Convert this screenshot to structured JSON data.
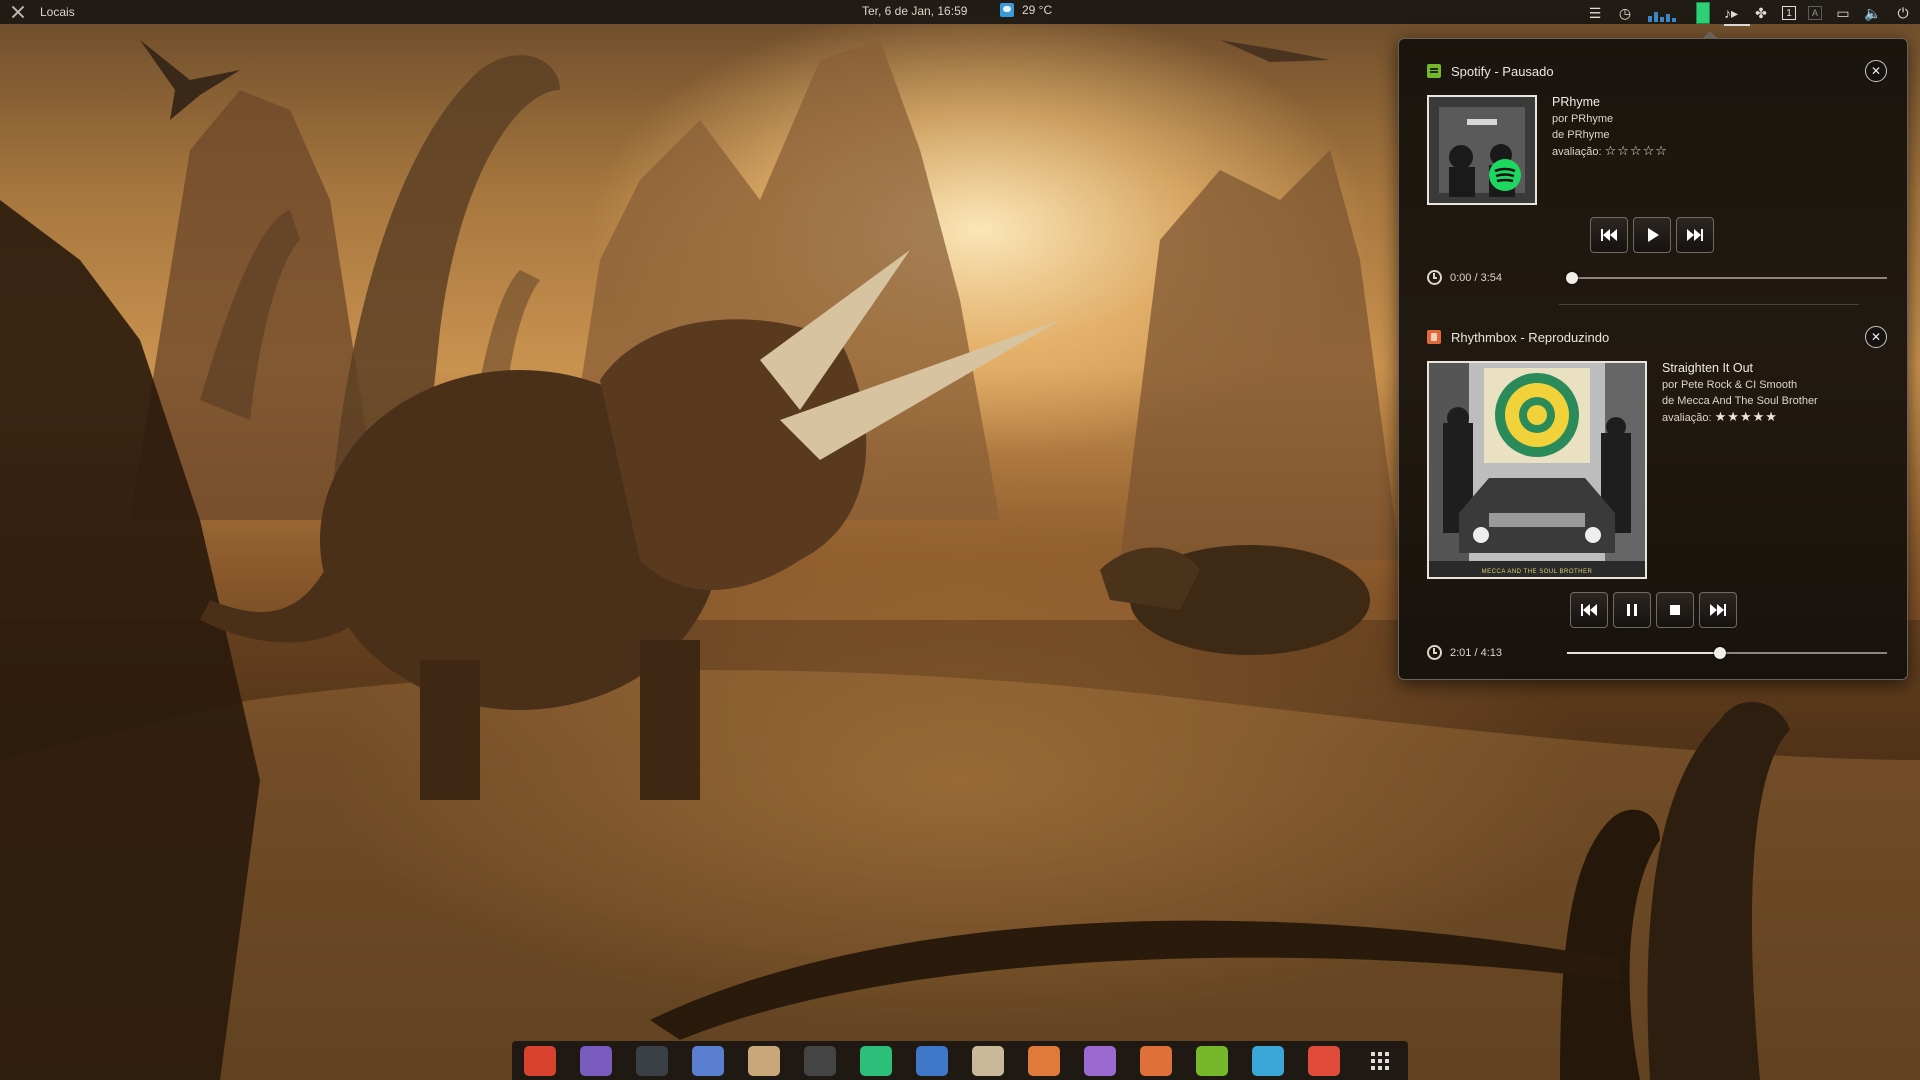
{
  "topbar": {
    "places_label": "Locais",
    "clock": "Ter, 6 de Jan, 16:59",
    "temperature": "29 °C",
    "tray_icons": [
      "settings-sliders-icon",
      "history-icon",
      "network-graph-icon",
      "battery-meter-icon",
      "music-note-icon",
      "extensions-icon",
      "workspace-1-icon",
      "keyboard-layout-icon",
      "display-icon",
      "volume-icon",
      "power-icon"
    ]
  },
  "players": [
    {
      "header": "Spotify - Pausado",
      "app_icon": "spotify-icon",
      "title": "PRhyme",
      "artist": "por PRhyme",
      "album": "de PRhyme",
      "rating_label": "avaliação:",
      "rating_stars": "☆☆☆☆☆",
      "rating": 0,
      "time": "0:00 / 3:54",
      "progress": 0.0,
      "controls": [
        "previous",
        "play",
        "next"
      ],
      "accent": "#76b82a"
    },
    {
      "header": "Rhythmbox - Reproduzindo",
      "app_icon": "rhythmbox-icon",
      "title": "Straighten It Out",
      "artist": "por Pete Rock & CI Smooth",
      "album": "de Mecca And The Soul Brother",
      "rating_label": "avaliação:",
      "rating_stars": "★★★★★",
      "rating": 5,
      "time": "2:01 / 4:13",
      "progress": 0.478,
      "controls": [
        "previous",
        "pause",
        "stop",
        "next"
      ],
      "accent": "#e06a3a",
      "cover_text": "MECCA AND THE SOUL BROTHER"
    }
  ],
  "dock": {
    "apps": [
      {
        "name": "chrome-icon",
        "color": "#d8422e"
      },
      {
        "name": "files-icon",
        "color": "#7a5cc0"
      },
      {
        "name": "terminal-icon",
        "color": "#3b3f46"
      },
      {
        "name": "window-manager-icon",
        "color": "#5a7fd0"
      },
      {
        "name": "archive-bag-icon",
        "color": "#c9a77a"
      },
      {
        "name": "screenshot-icon",
        "color": "#444"
      },
      {
        "name": "chat-icon",
        "color": "#2bbf7a"
      },
      {
        "name": "disk-utility-icon",
        "color": "#3f78c8"
      },
      {
        "name": "inkscape-icon",
        "color": "#c9b99a"
      },
      {
        "name": "fox-app-icon",
        "color": "#e07a3a"
      },
      {
        "name": "text-editor-icon",
        "color": "#9a6ad0"
      },
      {
        "name": "rhythmbox-icon",
        "color": "#e0703a"
      },
      {
        "name": "spotify-icon",
        "color": "#76b82a"
      },
      {
        "name": "pen-editor-icon",
        "color": "#3aa7d8"
      },
      {
        "name": "xampp-icon",
        "color": "#e04a3a"
      },
      {
        "name": "app-grid-icon",
        "color": "transparent"
      }
    ]
  }
}
